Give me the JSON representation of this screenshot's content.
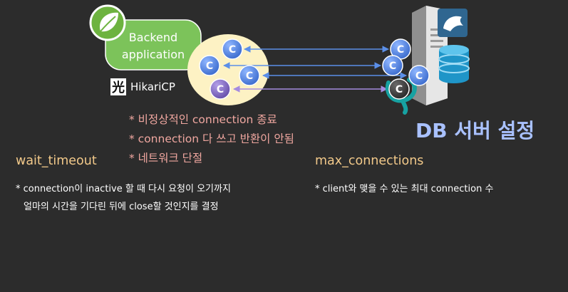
{
  "diagram": {
    "backend_label": [
      "Backend",
      "application"
    ],
    "pool_name": "HikariCP",
    "connection_letter": "C",
    "db_title": "DB 서버 설정"
  },
  "reasons": [
    "* 비정상적인 connection 종료",
    "* connection 다 쓰고 반환이 안됨",
    "* 네트워크 단절"
  ],
  "wait_timeout": {
    "heading": "wait_timeout",
    "lines": [
      "* connection이 inactive 할 때 다시 요청이 오기까지",
      "얼마의 시간을 기다린 뒤에 close할 것인지를 결정"
    ]
  },
  "max_connections": {
    "heading": "max_connections",
    "lines": [
      "* client와 맺을 수 있는 최대 connection 수"
    ]
  },
  "colors": {
    "background": "#2c2c2c",
    "backend_green": "#7cc35a",
    "pool_yellow": "#fdf2c4",
    "connection_blue": "#5b8fe8",
    "connection_purple": "#8b72c9",
    "db_title": "#a9c1ff",
    "reason_text": "#f0a7a0",
    "heading_text": "#f2c98a"
  }
}
